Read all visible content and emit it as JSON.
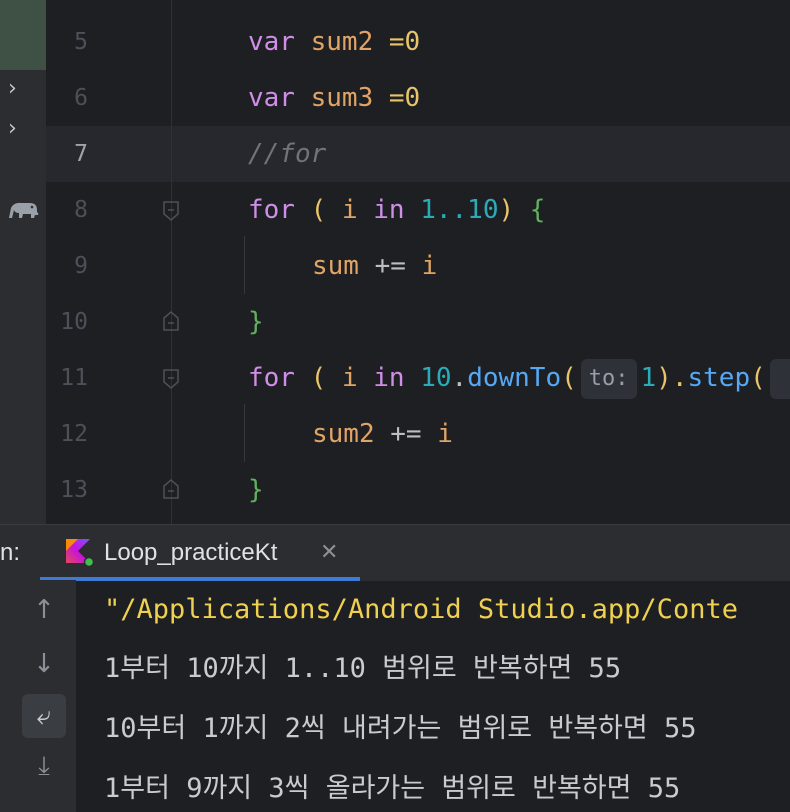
{
  "editor": {
    "lines": [
      {
        "num": "5"
      },
      {
        "num": "6"
      },
      {
        "num": "7"
      },
      {
        "num": "8"
      },
      {
        "num": "9"
      },
      {
        "num": "10"
      },
      {
        "num": "11"
      },
      {
        "num": "12"
      },
      {
        "num": "13"
      }
    ],
    "tokens": {
      "var": "var",
      "sum2": "sum2",
      "sum3": "sum3",
      "assign0": " =0",
      "comment": "//for",
      "for": "for",
      "open_paren": " ( ",
      "i": "i",
      "in": " in ",
      "range": "1..10",
      "close_brace_open": ") {",
      "sum": "sum",
      "plus_eq": " += ",
      "close_brace": "}",
      "ten": "10",
      "dot": ".",
      "downTo": "downTo",
      "paren_open": "(",
      "to_hint": "to:",
      "one": "1",
      "close_dot": ").",
      "step": "step",
      "paren_open2": "("
    }
  },
  "run": {
    "label": "n:",
    "tab_title": "Loop_practiceKt",
    "close_glyph": "✕",
    "console_lines": [
      "\"/Applications/Android Studio.app/Conte",
      "1부터 10까지 1..10 범위로 반복하면 55",
      "10부터 1까지 2씩 내려가는 범위로 반복하면 55",
      "1부터 9까지 3씩 올라가는 범위로 반복하면 55"
    ],
    "tools": [
      {
        "icon": "arrow-up-icon",
        "glyph": "↑"
      },
      {
        "icon": "arrow-down-icon",
        "glyph": "↓"
      },
      {
        "icon": "soft-wrap-icon",
        "glyph": "⤶"
      },
      {
        "icon": "scroll-to-end-icon",
        "glyph": "⤓"
      }
    ]
  },
  "colors": {
    "keyword": "#cf8ee8",
    "identifier": "#e0a466",
    "number": "#2aacb8",
    "function": "#56a8f5",
    "brace": "#5fb05f",
    "console_path": "#f0d050",
    "tab_underline": "#3d7bd6"
  }
}
